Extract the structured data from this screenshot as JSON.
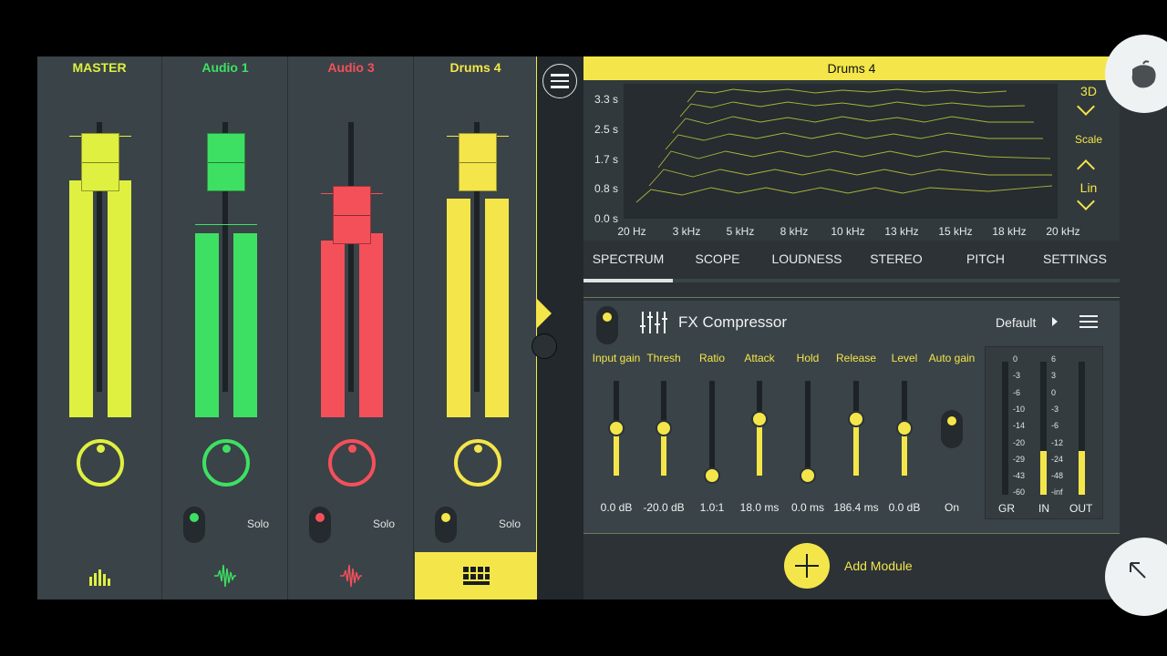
{
  "mixer": {
    "strips": [
      {
        "name": "MASTER",
        "color": "#dff040",
        "solo": null,
        "icon": "bars-icon",
        "selected": false
      },
      {
        "name": "Audio 1",
        "color": "#3ee063",
        "solo": "Solo",
        "icon": "waveform-icon",
        "selected": false
      },
      {
        "name": "Audio 3",
        "color": "#f4505a",
        "solo": "Solo",
        "icon": "waveform-icon",
        "selected": false
      },
      {
        "name": "Drums 4",
        "color": "#f4e64a",
        "solo": "Solo",
        "icon": "drum-pads-icon",
        "selected": true
      }
    ]
  },
  "analyzer": {
    "title": "Drums 4",
    "y_labels": [
      "3.3 s",
      "2.5 s",
      "1.7 s",
      "0.8 s",
      "0.0 s"
    ],
    "x_labels": [
      "20 Hz",
      "3 kHz",
      "5 kHz",
      "8 kHz",
      "10 kHz",
      "13 kHz",
      "15 kHz",
      "18 kHz",
      "20 kHz"
    ],
    "view_3d": "3D",
    "scale_label": "Scale",
    "scale_mode": "Lin"
  },
  "tabs": [
    "SPECTRUM",
    "SCOPE",
    "LOUDNESS",
    "STEREO",
    "PITCH",
    "SETTINGS"
  ],
  "module": {
    "title": "FX Compressor",
    "preset": "Default",
    "params": [
      {
        "label": "Input gain",
        "value": "0.0 dB",
        "level": 0.5
      },
      {
        "label": "Thresh",
        "value": "-20.0 dB",
        "level": 0.5
      },
      {
        "label": "Ratio",
        "value": "1.0:1",
        "level": 0.0
      },
      {
        "label": "Attack",
        "value": "18.0 ms",
        "level": 0.6
      },
      {
        "label": "Hold",
        "value": "0.0 ms",
        "level": 0.0
      },
      {
        "label": "Release",
        "value": "186.4 ms",
        "level": 0.6
      },
      {
        "label": "Level",
        "value": "0.0 dB",
        "level": 0.5
      }
    ],
    "auto_gain": {
      "label": "Auto gain",
      "value": "On"
    },
    "meters": {
      "gr_label": "GR",
      "in_label": "IN",
      "out_label": "OUT",
      "gr_scale": [
        "0",
        "-3",
        "-6",
        "-10",
        "-14",
        "-20",
        "-29",
        "-43",
        "-60"
      ],
      "io_scale": [
        "6",
        "3",
        "0",
        "-3",
        "-6",
        "-12",
        "-24",
        "-48",
        "-inf"
      ]
    }
  },
  "add_module": "Add Module"
}
